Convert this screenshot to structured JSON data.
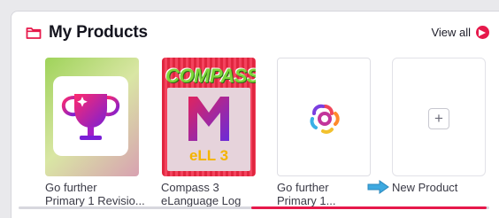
{
  "section": {
    "title": "My Products",
    "view_all_label": "View all"
  },
  "products": [
    {
      "line1": "Go further",
      "line2": "Primary 1 Revisio...",
      "icon": "trophy-icon"
    },
    {
      "line1": "Compass 3",
      "line2": "eLanguage Log",
      "cover_title": "COMPASS",
      "cover_badge": "eLL 3",
      "icon": "compass-m-logo-icon"
    },
    {
      "line1": "Go further",
      "line2": "Primary 1...",
      "icon": "go-further-flower-logo-icon"
    }
  ],
  "new_product": {
    "label": "New Product",
    "plus": "+",
    "icon": "arrow-pointer-icon"
  },
  "colors": {
    "accent": "#e6194b",
    "pointer": "#3da9e0"
  }
}
